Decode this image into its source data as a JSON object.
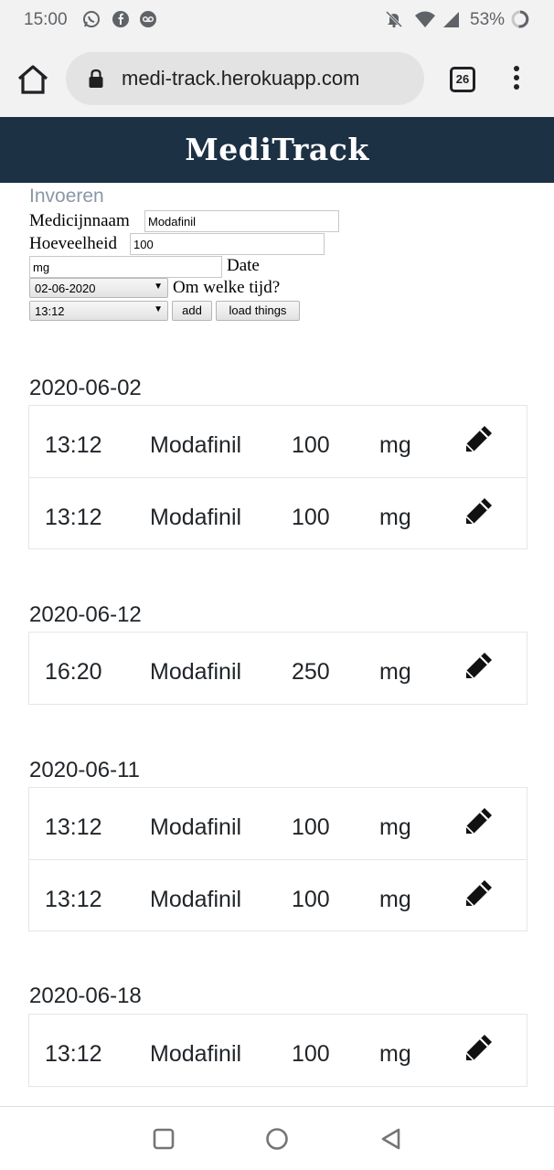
{
  "status_bar": {
    "time": "15:00",
    "icons_left": [
      "whatsapp-icon",
      "facebook-icon",
      "voicemail-icon"
    ],
    "icons_right": [
      "muted-bell-icon",
      "wifi-icon",
      "cell-signal-icon",
      "battery-circle-icon"
    ],
    "battery": "53%"
  },
  "browser": {
    "url": "medi-track.herokuapp.com",
    "tab_count": "26"
  },
  "app": {
    "title": "MediTrack"
  },
  "form": {
    "heading": "Invoeren",
    "name_label": "Medicijnnaam",
    "name_value": "Modafinil",
    "amount_label": "Hoeveelheid",
    "amount_value": "100",
    "unit_value": "mg",
    "date_label": "Date",
    "date_value": "02-06-2020",
    "time_label": "Om welke tijd?",
    "time_value": "13:12",
    "add_label": "add",
    "load_label": "load things"
  },
  "entry_groups": [
    {
      "date": "2020-06-02",
      "entries": [
        {
          "time": "13:12",
          "name": "Modafinil",
          "amount": "100",
          "unit": "mg"
        },
        {
          "time": "13:12",
          "name": "Modafinil",
          "amount": "100",
          "unit": "mg"
        }
      ]
    },
    {
      "date": "2020-06-12",
      "entries": [
        {
          "time": "16:20",
          "name": "Modafinil",
          "amount": "250",
          "unit": "mg"
        }
      ]
    },
    {
      "date": "2020-06-11",
      "entries": [
        {
          "time": "13:12",
          "name": "Modafinil",
          "amount": "100",
          "unit": "mg"
        },
        {
          "time": "13:12",
          "name": "Modafinil",
          "amount": "100",
          "unit": "mg"
        }
      ]
    },
    {
      "date": "2020-06-18",
      "entries": [
        {
          "time": "13:12",
          "name": "Modafinil",
          "amount": "100",
          "unit": "mg"
        }
      ]
    }
  ],
  "colors": {
    "header_bg": "#1d3145",
    "heading_muted": "#8a97a4",
    "status_bar_bg": "#f2f2f2"
  }
}
